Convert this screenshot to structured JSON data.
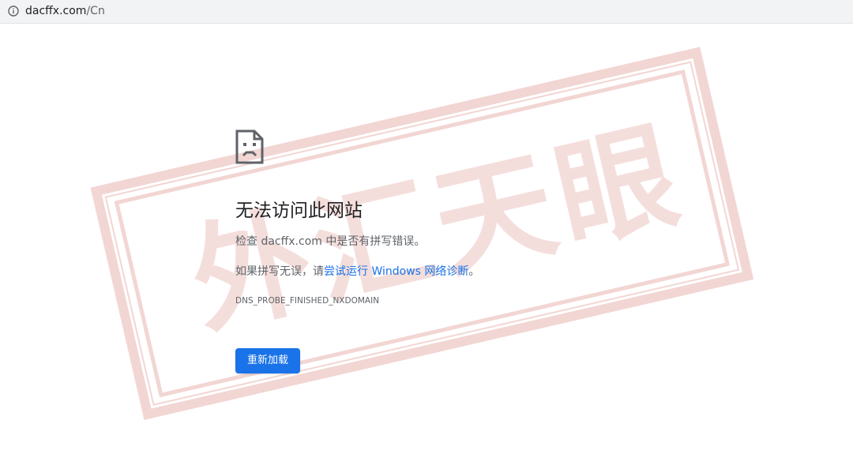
{
  "address_bar": {
    "domain": "dacffx.com",
    "path": "/Cn",
    "icon": "info-icon"
  },
  "error": {
    "icon": "sad-page-icon",
    "title": "无法访问此网站",
    "line1": "检查 dacffx.com 中是否有拼写错误。",
    "line2_prefix": "如果拼写无误，请",
    "line2_link": "尝试运行 Windows 网络诊断",
    "line2_suffix": "。",
    "code": "DNS_PROBE_FINISHED_NXDOMAIN",
    "reload_label": "重新加载"
  },
  "watermark": {
    "text": "外汇天眼",
    "color": "#c0392b"
  },
  "colors": {
    "link": "#1a73e8",
    "button": "#1a73e8",
    "title": "#202124",
    "body": "#5f6368",
    "address_bar_bg": "#f1f3f4"
  }
}
